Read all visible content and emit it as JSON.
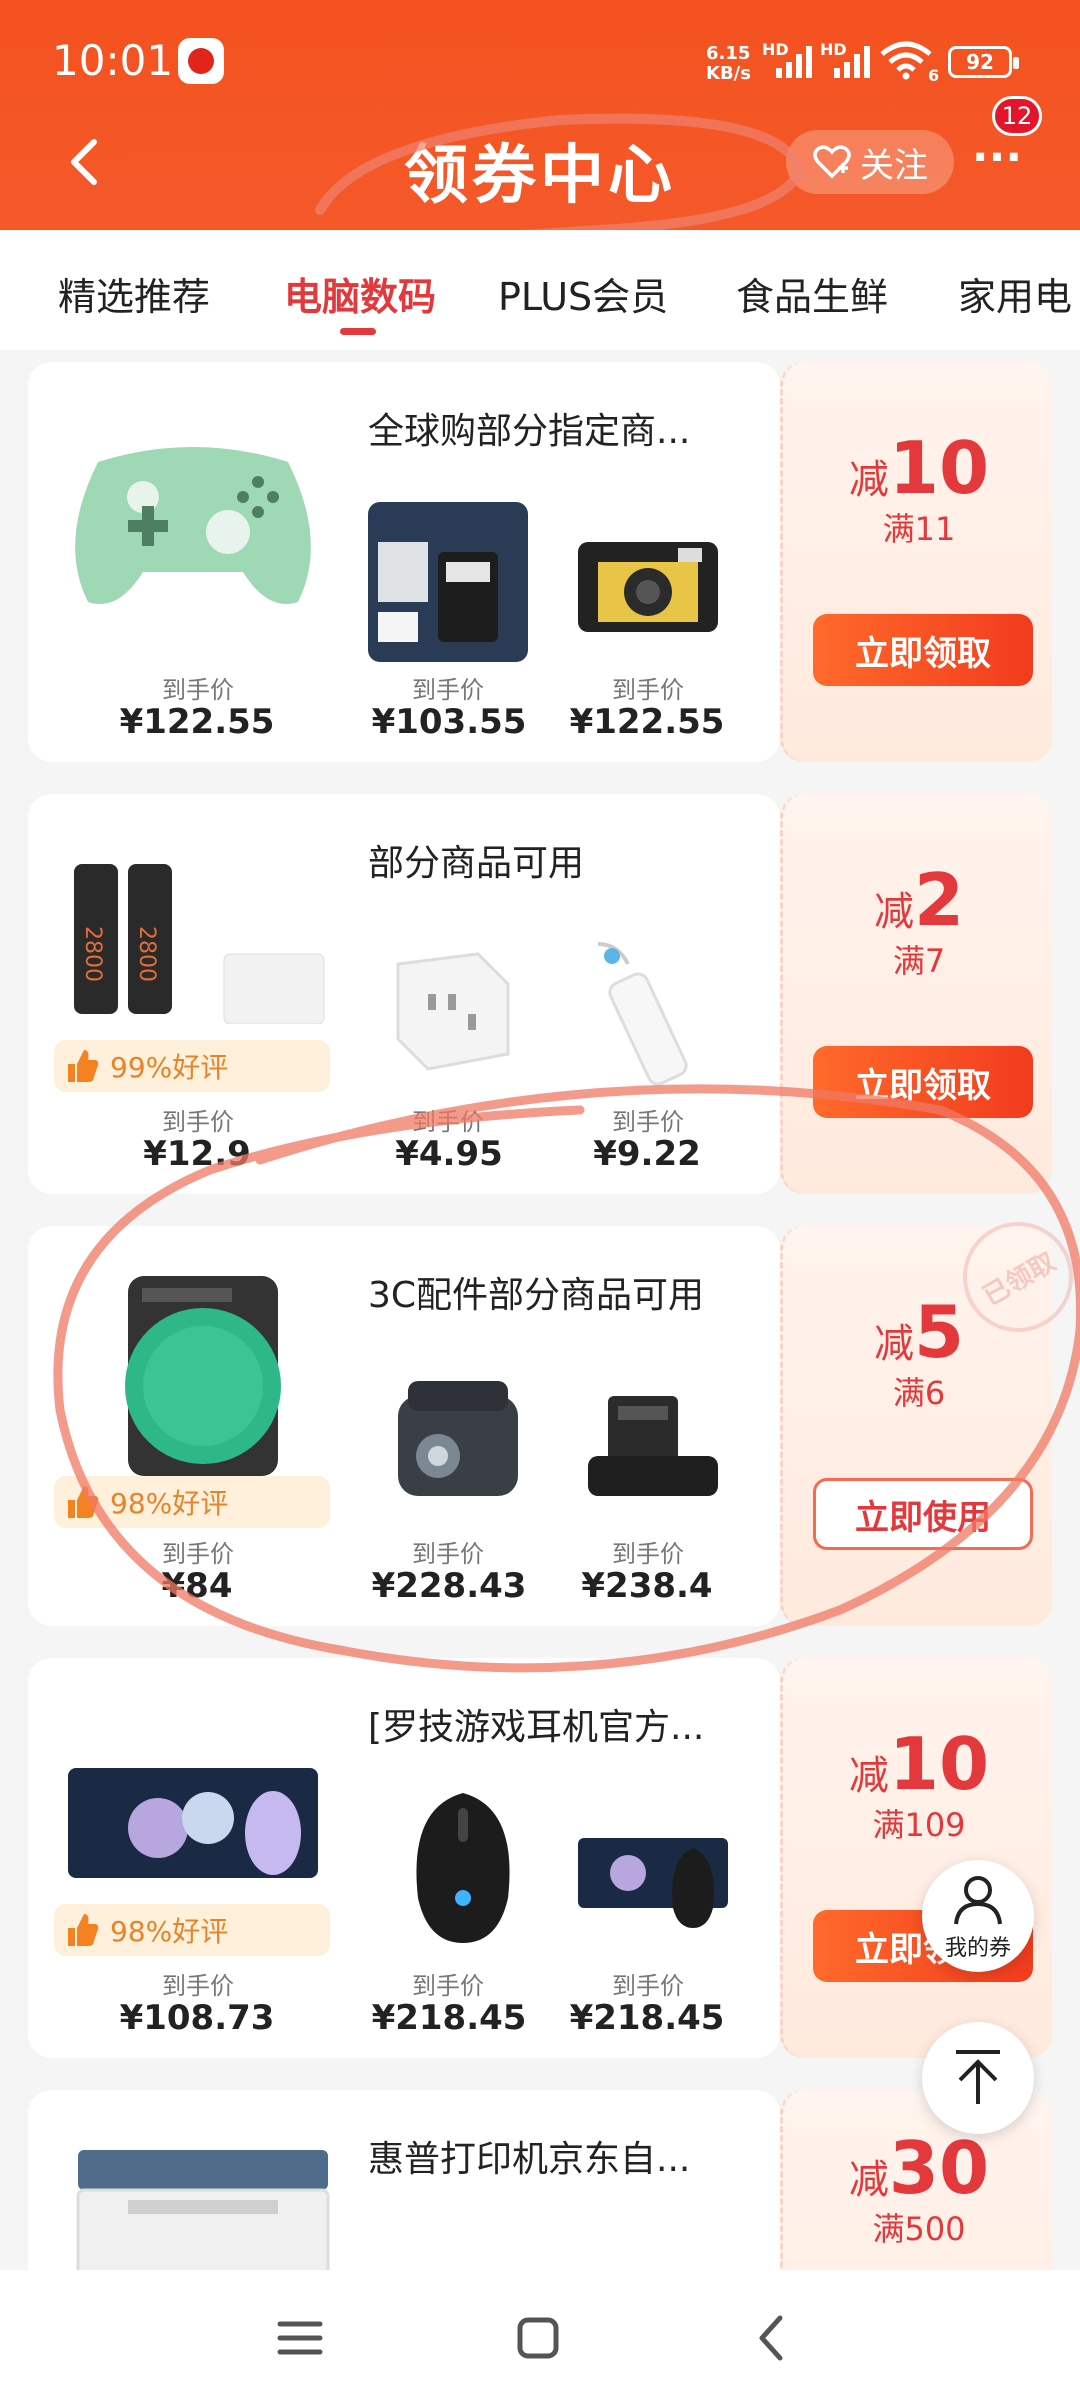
{
  "status": {
    "time": "10:01",
    "net_speed_top": "6.15",
    "net_speed_bottom": "KB/s",
    "sig1": "HD",
    "sig2": "HD",
    "battery": "92",
    "wifi_label": "6"
  },
  "header": {
    "title": "领券中心",
    "follow_label": "关注",
    "more_label": "···",
    "notification_count": "12"
  },
  "tabs": [
    {
      "label": "精选推荐"
    },
    {
      "label": "电脑数码"
    },
    {
      "label": "PLUS会员"
    },
    {
      "label": "食品生鲜"
    },
    {
      "label": "家用电"
    }
  ],
  "colors": {
    "brand": "#f4521f",
    "accent": "#e4393c",
    "button": "#f23b1e",
    "rating_bg": "#fff0dc"
  },
  "cards": [
    {
      "name": "全球购部分指定商...",
      "discount_prefix": "减",
      "discount": "10",
      "threshold": "满11",
      "button": "立即领取",
      "products": [
        {
          "label": "到手价",
          "price": "¥122.55"
        },
        {
          "label": "到手价",
          "price": "¥103.55"
        },
        {
          "label": "到手价",
          "price": "¥122.55"
        }
      ]
    },
    {
      "name": "部分商品可用",
      "rating": "99%好评",
      "discount_prefix": "减",
      "discount": "2",
      "threshold": "满7",
      "button": "立即领取",
      "products": [
        {
          "label": "到手价",
          "price": "¥12.9"
        },
        {
          "label": "到手价",
          "price": "¥4.95"
        },
        {
          "label": "到手价",
          "price": "¥9.22"
        }
      ]
    },
    {
      "name": "3C配件部分商品可用",
      "rating": "98%好评",
      "discount_prefix": "减",
      "discount": "5",
      "threshold": "满6",
      "button": "立即使用",
      "stamp": "已领取",
      "products": [
        {
          "label": "到手价",
          "price": "¥84"
        },
        {
          "label": "到手价",
          "price": "¥228.43"
        },
        {
          "label": "到手价",
          "price": "¥238.4"
        }
      ]
    },
    {
      "name": "[罗技游戏耳机官方...",
      "rating": "98%好评",
      "discount_prefix": "减",
      "discount": "10",
      "threshold": "满109",
      "button": "立即领取",
      "products": [
        {
          "label": "到手价",
          "price": "¥108.73"
        },
        {
          "label": "到手价",
          "price": "¥218.45"
        },
        {
          "label": "到手价",
          "price": "¥218.45"
        }
      ]
    },
    {
      "name": "惠普打印机京东自...",
      "discount_prefix": "减",
      "discount": "30",
      "threshold": "满500"
    }
  ],
  "floating": {
    "my_coupons": "我的券"
  },
  "icons": {
    "back": "back-arrow-icon",
    "follow": "heart-plus-icon",
    "my_coupons": "person-icon",
    "to_top": "arrow-up-to-top-icon",
    "nav_menu": "menu-icon",
    "nav_home": "home-square-icon",
    "nav_back": "nav-back-icon"
  }
}
